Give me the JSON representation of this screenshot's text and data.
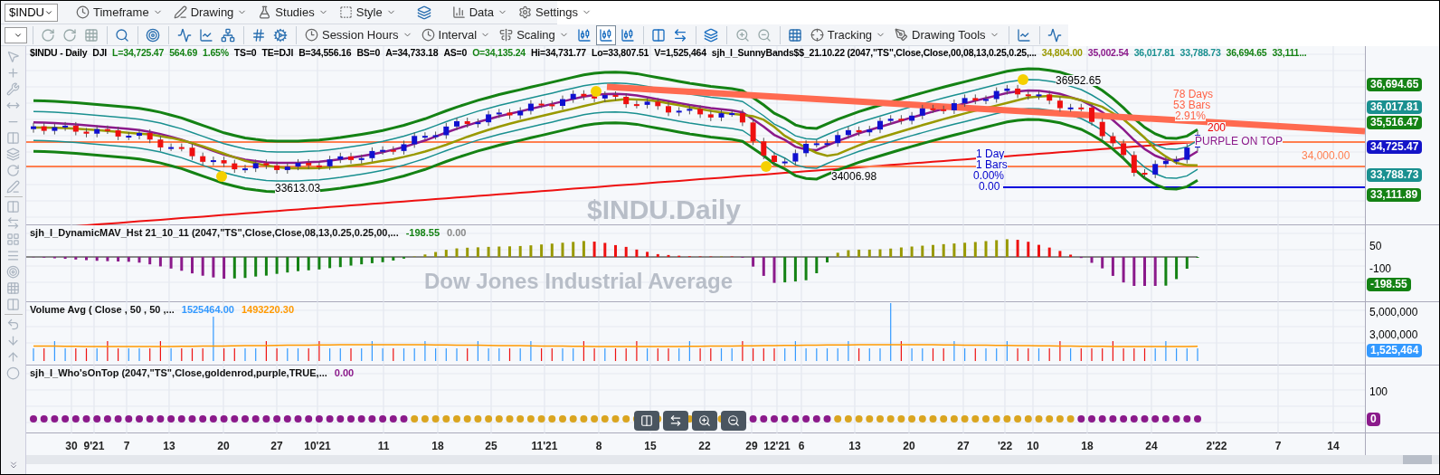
{
  "toolbar_top": {
    "symbol": "$INDU",
    "menus": [
      {
        "label": "Timeframe"
      },
      {
        "label": "Drawing"
      },
      {
        "label": "Studies"
      },
      {
        "label": "Style"
      },
      {
        "label": "Data"
      },
      {
        "label": "Settings"
      }
    ]
  },
  "toolbar_second": {
    "menus": [
      {
        "label": "Session Hours"
      },
      {
        "label": "Interval"
      },
      {
        "label": "Scaling"
      }
    ],
    "chart_type_buttons": [
      {
        "selected": false
      },
      {
        "selected": true
      },
      {
        "selected": false
      }
    ],
    "menus_right": [
      {
        "label": "Tracking"
      },
      {
        "label": "Drawing Tools"
      }
    ]
  },
  "header": [
    {
      "text": "$INDU - Daily",
      "color": "#000000"
    },
    {
      "text": "DJI",
      "color": "#000000"
    },
    {
      "text": "L=34,725.47",
      "color": "#148214"
    },
    {
      "text": "564.69",
      "color": "#148214"
    },
    {
      "text": "1.65%",
      "color": "#148214"
    },
    {
      "text": "TS=0",
      "color": "#000000"
    },
    {
      "text": "TE=DJI",
      "color": "#000000"
    },
    {
      "text": "B=34,556.16",
      "color": "#000000"
    },
    {
      "text": "BS=0",
      "color": "#000000"
    },
    {
      "text": "A=34,733.18",
      "color": "#000000"
    },
    {
      "text": "AS=0",
      "color": "#000000"
    },
    {
      "text": "O=34,135.24",
      "color": "#148214"
    },
    {
      "text": "Hi=34,731.77",
      "color": "#000000"
    },
    {
      "text": "Lo=33,807.51",
      "color": "#000000"
    },
    {
      "text": "V=1,525,464",
      "color": "#000000"
    },
    {
      "text": "sjh_I_SunnyBands$$_21.10.22 (2047,\"TS\",Close,Close,00,08,13,0.25,0.25,...",
      "color": "#000000"
    },
    {
      "text": "34,804.00",
      "color": "#999900"
    },
    {
      "text": "35,002.54",
      "color": "#8b1a8b"
    },
    {
      "text": "36,017.81",
      "color": "#1a9090"
    },
    {
      "text": "33,788.73",
      "color": "#1a9090"
    },
    {
      "text": "36,694.65",
      "color": "#148214"
    },
    {
      "text": "33,111...",
      "color": "#148214"
    }
  ],
  "watermark": {
    "title": "$INDU.Daily",
    "subtitle": "Dow Jones Industrial Average"
  },
  "annotations": [
    {
      "text": "36952.65",
      "color": "#000000"
    },
    {
      "text": "78 Days",
      "color": "#ff6347"
    },
    {
      "text": "53 Bars",
      "color": "#ff6347"
    },
    {
      "text": "2.91%",
      "color": "#ff6347"
    },
    {
      "text": "200",
      "color": "#ee0000"
    },
    {
      "text": "PURPLE ON TOP",
      "color": "#8b1a8b"
    },
    {
      "text": "1 Day",
      "color": "#0000cc"
    },
    {
      "text": "34,000.00",
      "color": "#ff7f50"
    },
    {
      "text": "1 Bars",
      "color": "#0000cc"
    },
    {
      "text": "34006.98",
      "color": "#000000"
    },
    {
      "text": "0.00%",
      "color": "#0000cc"
    },
    {
      "text": "33613.03",
      "color": "#000000"
    },
    {
      "text": "0.00",
      "color": "#0000cc"
    }
  ],
  "price_tags": [
    {
      "text": "36,694.65",
      "color": "#148214"
    },
    {
      "text": "36,017.81",
      "color": "#1a9090"
    },
    {
      "text": "35,516.47",
      "color": "#148214"
    },
    {
      "text": "34,725.47",
      "color": "#1414c8"
    },
    {
      "text": "33,788.73",
      "color": "#1a9090"
    },
    {
      "text": "33,111.89",
      "color": "#148214"
    }
  ],
  "histogram_pane": {
    "title": "sjh_I_DynamicMAV_Hst 21_10_11 (2047,\"TS\",Close,Close,08,13,0.25,0.25,00,...",
    "values": [
      {
        "text": "-198.55",
        "color": "#148214"
      },
      {
        "text": "0.00",
        "color": "#888888"
      }
    ],
    "axis": [
      "50",
      "-100"
    ],
    "tag": {
      "text": "-198.55",
      "color": "#148214"
    }
  },
  "volume_pane": {
    "title": "Volume Avg ( Close , 50 , 50 ,...",
    "values": [
      {
        "text": "1525464.00",
        "color": "#3399ff"
      },
      {
        "text": "1493220.30",
        "color": "#ff9900"
      }
    ],
    "axis": [
      "5,000,000",
      "3,000,000"
    ],
    "tag": {
      "text": "1,525,464",
      "color": "#3399ff"
    }
  },
  "whos_on_top_pane": {
    "title": "sjh_I_Who'sOnTop (2047,\"TS\",Close,goldenrod,purple,TRUE,...",
    "values": [
      {
        "text": "0.00",
        "color": "#8b1a8b"
      }
    ],
    "axis": [
      "100"
    ],
    "tag": {
      "text": "0",
      "color": "#8b1a8b"
    }
  },
  "x_axis": [
    "30",
    "9'21",
    "7",
    "13",
    "20",
    "27",
    "10'21",
    "11",
    "18",
    "25",
    "11'21",
    "8",
    "15",
    "22",
    "29",
    "12'21",
    "6",
    "13",
    "20",
    "27",
    "'22",
    "10",
    "18",
    "24",
    "2'22",
    "7",
    "14"
  ]
}
